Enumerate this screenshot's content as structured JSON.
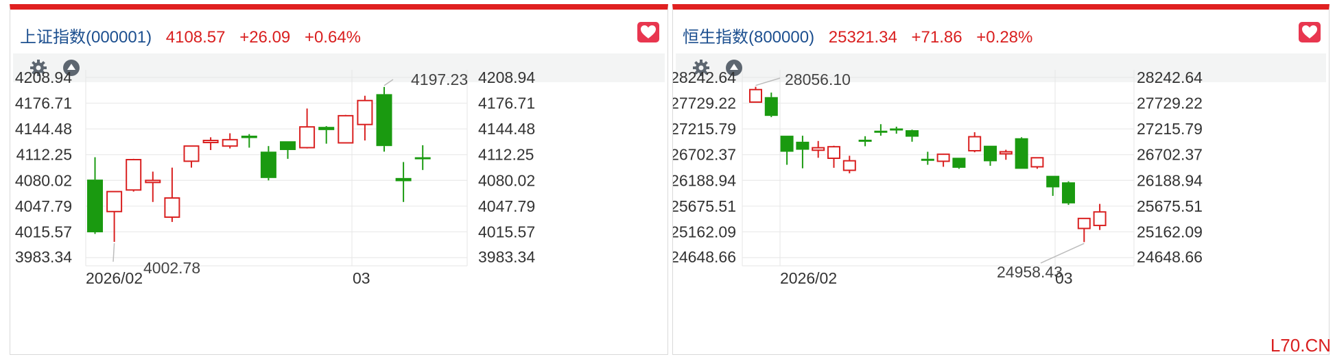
{
  "panels": [
    {
      "name": "上证指数(000001)",
      "price": "4108.57",
      "change": "+26.09",
      "change_pct": "+0.64%"
    },
    {
      "name": "恒生指数(800000)",
      "price": "25321.34",
      "change": "+71.86",
      "change_pct": "+0.28%"
    }
  ],
  "colors": {
    "up": "#d91f1f",
    "down": "#1a9a10",
    "accent": "#e02020",
    "name": "#1c4f8f"
  },
  "icons": {
    "settings": "gear-icon",
    "collapse": "triangle-up-icon",
    "favorite": "heart-icon"
  },
  "watermark": "L70.CN",
  "chart_data": [
    {
      "type": "candlestick",
      "yticks": [
        "4208.94",
        "4176.71",
        "4144.48",
        "4112.25",
        "4080.02",
        "4047.79",
        "4015.57",
        "3983.34"
      ],
      "ylim": [
        3983.34,
        4208.94
      ],
      "xticks": [
        "2026/02",
        "03"
      ],
      "max_label": "4197.23",
      "min_label": "4002.78",
      "candles": [
        {
          "o": 4081,
          "c": 4015,
          "h": 4109,
          "l": 4013
        },
        {
          "o": 4041,
          "c": 4066,
          "h": 4066,
          "l": 4003
        },
        {
          "o": 4068,
          "c": 4106,
          "h": 4107,
          "l": 4066
        },
        {
          "o": 4079,
          "c": 4080,
          "h": 4091,
          "l": 4053
        },
        {
          "o": 4034,
          "c": 4058,
          "h": 4096,
          "l": 4028
        },
        {
          "o": 4104,
          "c": 4123,
          "h": 4123,
          "l": 4096
        },
        {
          "o": 4128,
          "c": 4130,
          "h": 4134,
          "l": 4118
        },
        {
          "o": 4123,
          "c": 4131,
          "h": 4139,
          "l": 4120
        },
        {
          "o": 4136,
          "c": 4133,
          "h": 4138,
          "l": 4121
        },
        {
          "o": 4116,
          "c": 4083,
          "h": 4123,
          "l": 4080
        },
        {
          "o": 4129,
          "c": 4118,
          "h": 4129,
          "l": 4107
        },
        {
          "o": 4121,
          "c": 4147,
          "h": 4170,
          "l": 4120
        },
        {
          "o": 4147,
          "c": 4143,
          "h": 4148,
          "l": 4126
        },
        {
          "o": 4127,
          "c": 4161,
          "h": 4162,
          "l": 4127
        },
        {
          "o": 4150,
          "c": 4180,
          "h": 4186,
          "l": 4130
        },
        {
          "o": 4188,
          "c": 4123,
          "h": 4197,
          "l": 4116
        },
        {
          "o": 4083,
          "c": 4079,
          "h": 4103,
          "l": 4053
        },
        {
          "o": 4109,
          "c": 4108,
          "h": 4124,
          "l": 4093
        }
      ]
    },
    {
      "type": "candlestick",
      "yticks": [
        "28242.64",
        "27729.22",
        "27215.79",
        "26702.37",
        "26188.94",
        "25675.51",
        "25162.09",
        "24648.66"
      ],
      "ylim": [
        24648.66,
        28242.64
      ],
      "xticks": [
        "2026/02",
        "03"
      ],
      "max_label": "28056.10",
      "min_label": "24958.43",
      "candles": [
        {
          "o": 27750,
          "c": 28000,
          "h": 28056,
          "l": 27750
        },
        {
          "o": 27850,
          "c": 27475,
          "h": 27940,
          "l": 27450
        },
        {
          "o": 27080,
          "c": 26760,
          "h": 27080,
          "l": 26500
        },
        {
          "o": 26960,
          "c": 26800,
          "h": 27080,
          "l": 26430
        },
        {
          "o": 26790,
          "c": 26840,
          "h": 26975,
          "l": 26640
        },
        {
          "o": 26630,
          "c": 26860,
          "h": 26880,
          "l": 26440
        },
        {
          "o": 26390,
          "c": 26580,
          "h": 26680,
          "l": 26330
        },
        {
          "o": 27000,
          "c": 26960,
          "h": 27070,
          "l": 26870
        },
        {
          "o": 27180,
          "c": 27170,
          "h": 27310,
          "l": 27080
        },
        {
          "o": 27225,
          "c": 27215,
          "h": 27260,
          "l": 27120
        },
        {
          "o": 27190,
          "c": 27060,
          "h": 27200,
          "l": 26960
        },
        {
          "o": 26620,
          "c": 26590,
          "h": 26760,
          "l": 26500
        },
        {
          "o": 26570,
          "c": 26710,
          "h": 26720,
          "l": 26460
        },
        {
          "o": 26640,
          "c": 26440,
          "h": 26640,
          "l": 26420
        },
        {
          "o": 26780,
          "c": 27060,
          "h": 27150,
          "l": 26750
        },
        {
          "o": 26880,
          "c": 26570,
          "h": 26880,
          "l": 26480
        },
        {
          "o": 26750,
          "c": 26760,
          "h": 26800,
          "l": 26600
        },
        {
          "o": 27030,
          "c": 26420,
          "h": 27050,
          "l": 26420
        },
        {
          "o": 26460,
          "c": 26640,
          "h": 26640,
          "l": 26420
        },
        {
          "o": 26280,
          "c": 26050,
          "h": 26280,
          "l": 25880
        },
        {
          "o": 26150,
          "c": 25730,
          "h": 26170,
          "l": 25700
        },
        {
          "o": 25230,
          "c": 25430,
          "h": 25430,
          "l": 24958
        },
        {
          "o": 25290,
          "c": 25560,
          "h": 25720,
          "l": 25200
        }
      ]
    }
  ]
}
